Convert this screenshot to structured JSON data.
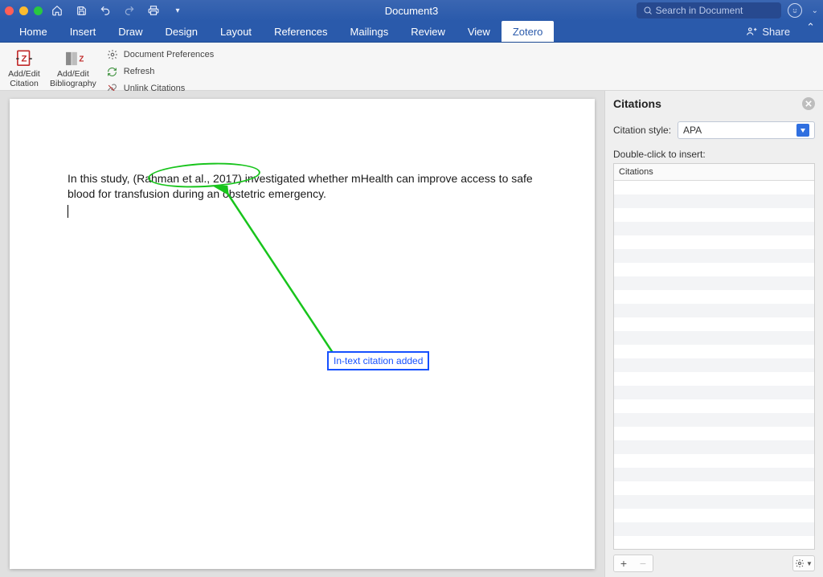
{
  "titlebar": {
    "document_name": "Document3",
    "search_placeholder": "Search in Document"
  },
  "menu": {
    "items": [
      "Home",
      "Insert",
      "Draw",
      "Design",
      "Layout",
      "References",
      "Mailings",
      "Review",
      "View",
      "Zotero"
    ],
    "active_index": 9,
    "share_label": "Share"
  },
  "ribbon": {
    "add_edit_citation": "Add/Edit\nCitation",
    "add_edit_bibliography": "Add/Edit\nBibliography",
    "doc_prefs": "Document Preferences",
    "refresh": "Refresh",
    "unlink": "Unlink Citations"
  },
  "document": {
    "para_pre": "In this study, ",
    "citation": "(Rahman et al., 2017)",
    "para_post": " investigated whether mHealth can improve access to safe blood for transfusion during an obstetric emergency."
  },
  "annotation": {
    "callout": "In-text citation added"
  },
  "panel": {
    "title": "Citations",
    "style_label": "Citation style:",
    "style_value": "APA",
    "insert_hint": "Double-click to insert:",
    "list_header": "Citations"
  }
}
